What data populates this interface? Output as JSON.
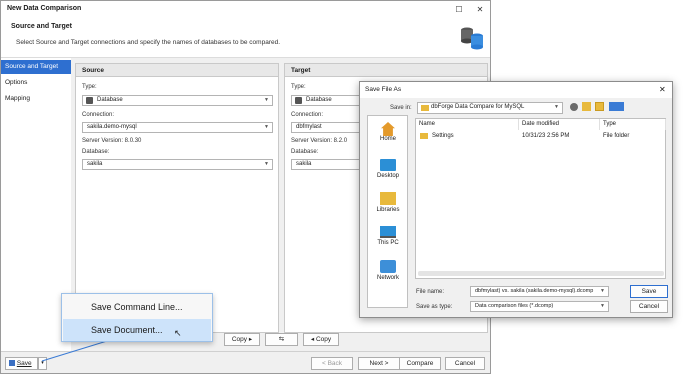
{
  "window": {
    "title": "New Data Comparison",
    "header_title": "Source and Target",
    "header_subtitle": "Select Source and Target connections and specify the names of databases to be compared."
  },
  "sidebar": {
    "items": [
      {
        "label": "Source and Target"
      },
      {
        "label": "Options"
      },
      {
        "label": "Mapping"
      }
    ]
  },
  "source": {
    "heading": "Source",
    "type_label": "Type:",
    "type_value": "Database",
    "connection_label": "Connection:",
    "connection_value": "sakila.demo-mysql",
    "server_version": "Server Version: 8.0.30",
    "database_label": "Database:",
    "database_value": "sakila"
  },
  "target": {
    "heading": "Target",
    "type_label": "Type:",
    "type_value": "Database",
    "connection_label": "Connection:",
    "connection_value": "dbfmylast",
    "server_version": "Server Version: 8.2.0",
    "database_label": "Database:",
    "database_value": "sakila"
  },
  "mid": {
    "copy_right": "Copy",
    "swap": "⇆",
    "copy_left": "Copy"
  },
  "footer": {
    "save": "Save",
    "back": "< Back",
    "next": "Next >",
    "compare": "Compare",
    "cancel": "Cancel"
  },
  "menu": {
    "items": [
      {
        "label": "Save Command Line..."
      },
      {
        "label": "Save Document..."
      }
    ]
  },
  "dialog": {
    "title": "Save File As",
    "save_in_label": "Save in:",
    "save_in_value": "dbForge Data Compare for MySQL",
    "places": [
      {
        "label": "Home",
        "icon": "home-icon"
      },
      {
        "label": "Desktop",
        "icon": "desktop-icon"
      },
      {
        "label": "Libraries",
        "icon": "libraries-icon"
      },
      {
        "label": "This PC",
        "icon": "this-pc-icon"
      },
      {
        "label": "Network",
        "icon": "network-icon"
      }
    ],
    "columns": [
      "Name",
      "Date modified",
      "Type"
    ],
    "files": [
      {
        "name": "Settings",
        "date": "10/31/23 2:56 PM",
        "type": "File folder"
      }
    ],
    "file_name_label": "File name:",
    "file_name_value": "dbfmylast) vs. sakila (sakila.demo-mysql).dcomp",
    "save_as_label": "Save as type:",
    "save_as_value": "Data comparison files (*.dcomp)",
    "save": "Save",
    "cancel": "Cancel"
  }
}
